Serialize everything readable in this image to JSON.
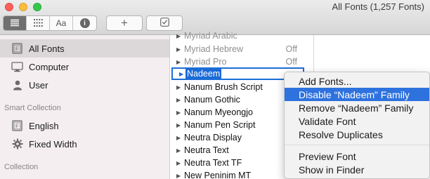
{
  "window": {
    "title": "All Fonts (1,257 Fonts)"
  },
  "toolbar": {
    "view_buttons": [
      {
        "icon": "list-view-icon",
        "active": true
      },
      {
        "icon": "grid-view-icon",
        "active": false
      },
      {
        "icon": "font-sample-icon",
        "label": "Aa",
        "active": false
      },
      {
        "icon": "info-icon",
        "label": "i",
        "active": false
      }
    ],
    "add_label": "+",
    "validate_icon": "checkbox-icon"
  },
  "sidebar": {
    "items": [
      {
        "label": "All Fonts",
        "icon": "font-book-icon",
        "selected": true
      },
      {
        "label": "Computer",
        "icon": "computer-icon",
        "selected": false
      },
      {
        "label": "User",
        "icon": "user-icon",
        "selected": false
      }
    ],
    "smart_collection_heading": "Smart Collection",
    "smart_items": [
      {
        "label": "English",
        "icon": "font-book-icon"
      },
      {
        "label": "Fixed Width",
        "icon": "gear-icon"
      }
    ],
    "collection_heading": "Collection"
  },
  "font_list": {
    "rows": [
      {
        "name": "Myriad Arabic",
        "state": "",
        "dim": true
      },
      {
        "name": "Myriad Hebrew",
        "state": "Off",
        "dim": true
      },
      {
        "name": "Myriad Pro",
        "state": "Off",
        "dim": true
      },
      {
        "name": "Nadeem",
        "state": "",
        "dim": false,
        "selected": true
      },
      {
        "name": "Nanum Brush Script",
        "state": "",
        "dim": false
      },
      {
        "name": "Nanum Gothic",
        "state": "",
        "dim": false
      },
      {
        "name": "Nanum Myeongjo",
        "state": "",
        "dim": false
      },
      {
        "name": "Nanum Pen Script",
        "state": "",
        "dim": false
      },
      {
        "name": "Neutra Display",
        "state": "",
        "dim": false
      },
      {
        "name": "Neutra Text",
        "state": "",
        "dim": false
      },
      {
        "name": "Neutra Text TF",
        "state": "",
        "dim": false
      },
      {
        "name": "New Peninim MT",
        "state": "",
        "dim": false
      }
    ]
  },
  "context_menu": {
    "items": [
      {
        "label": "Add Fonts...",
        "highlighted": false
      },
      {
        "label": "Disable “Nadeem” Family",
        "highlighted": true
      },
      {
        "label": "Remove “Nadeem” Family",
        "highlighted": false
      },
      {
        "label": "Validate Font",
        "highlighted": false
      },
      {
        "label": "Resolve Duplicates",
        "highlighted": false
      }
    ],
    "items_after_separator": [
      {
        "label": "Preview Font"
      },
      {
        "label": "Show in Finder"
      }
    ]
  }
}
